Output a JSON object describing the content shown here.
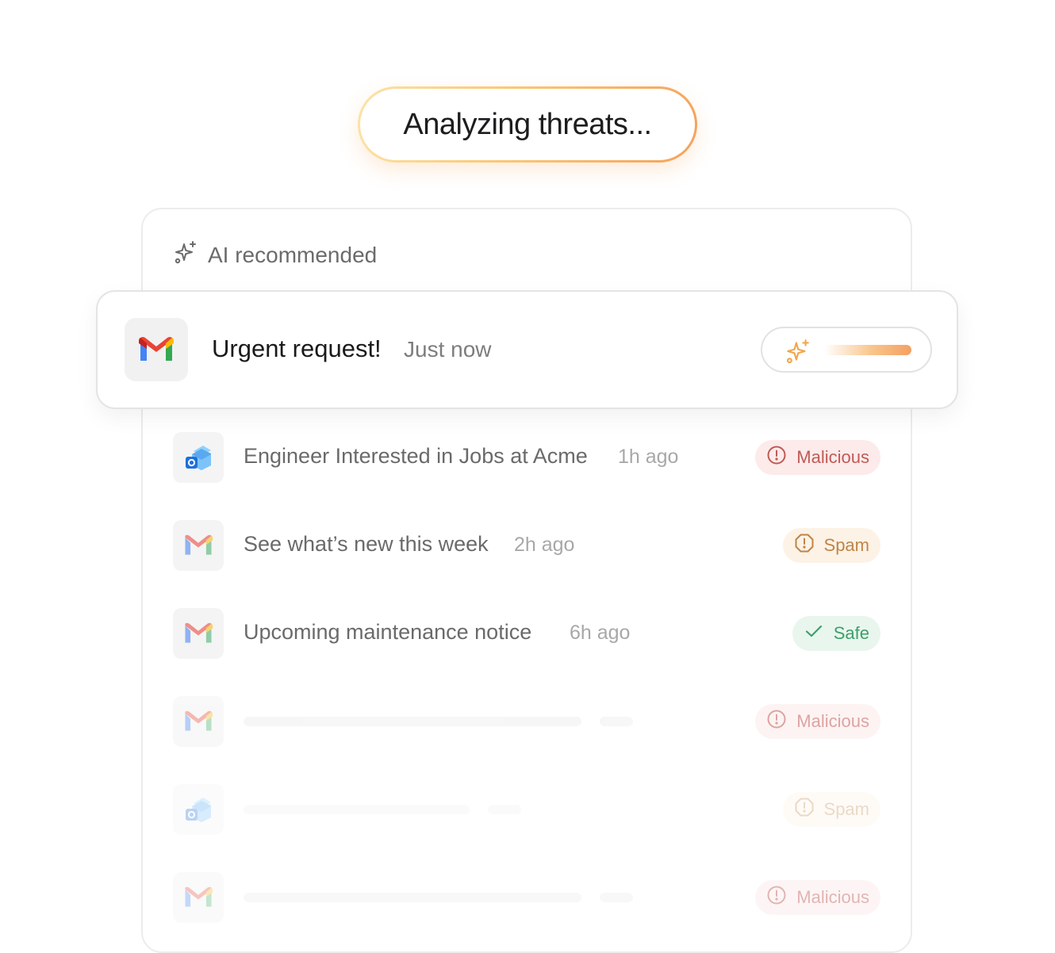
{
  "status": {
    "label": "Analyzing threats..."
  },
  "section": {
    "label": "AI recommended",
    "icon": "sparkles-icon"
  },
  "featured": {
    "app_icon": "gmail-icon",
    "subject": "Urgent request!",
    "time": "Just now",
    "progress_icon": "sparkles-icon"
  },
  "emails": [
    {
      "app_icon": "outlook-icon",
      "subject": "Engineer Interested in Jobs at Acme",
      "time": "1h ago",
      "status": "Malicious",
      "status_icon": "alert-circle-icon"
    },
    {
      "app_icon": "gmail-icon",
      "subject": "See what’s new this week",
      "time": "2h ago",
      "status": "Spam",
      "status_icon": "alert-octagon-icon"
    },
    {
      "app_icon": "gmail-icon",
      "subject": "Upcoming maintenance notice",
      "time": "6h ago",
      "status": "Safe",
      "status_icon": "check-icon"
    },
    {
      "app_icon": "gmail-icon",
      "subject": "",
      "time": "",
      "status": "Malicious",
      "status_icon": "alert-circle-icon"
    },
    {
      "app_icon": "outlook-icon",
      "subject": "",
      "time": "",
      "status": "Spam",
      "status_icon": "alert-octagon-icon"
    },
    {
      "app_icon": "gmail-icon",
      "subject": "",
      "time": "",
      "status": "Malicious",
      "status_icon": "alert-circle-icon"
    }
  ],
  "colors": {
    "malicious": "#c05a57",
    "spam": "#c08446",
    "safe": "#3f9e6a",
    "accent_gradient_start": "#fbe3a8",
    "accent_gradient_end": "#f5a25c"
  }
}
